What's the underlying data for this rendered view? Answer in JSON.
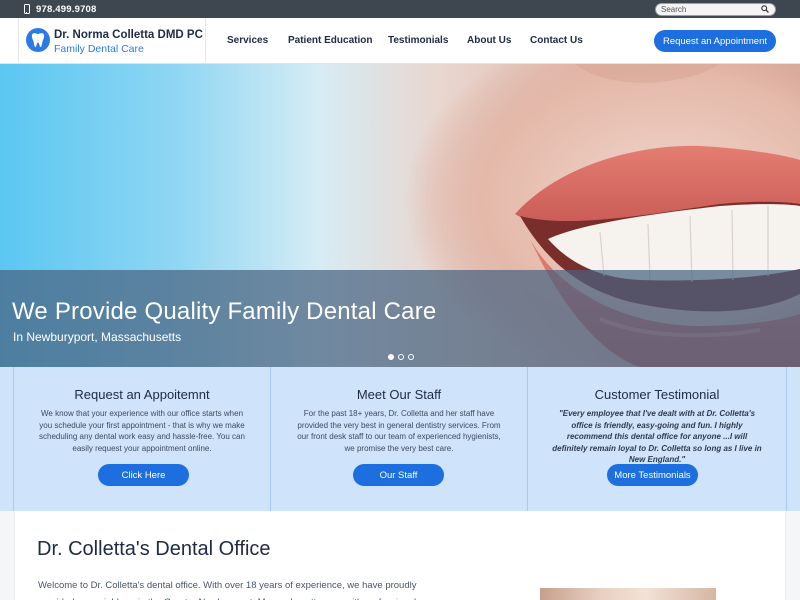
{
  "topbar": {
    "phone": "978.499.9708",
    "search_placeholder": "Search"
  },
  "header": {
    "brand_name": "Dr. Norma Colletta DMD PC",
    "brand_sub": "Family Dental Care",
    "nav": [
      "Services",
      "Patient Education",
      "Testimonials",
      "About Us",
      "Contact Us"
    ],
    "cta": "Request an Appointment"
  },
  "hero": {
    "title": "We Provide Quality Family Dental Care",
    "subtitle": "In Newburyport, Massachusetts",
    "slide_count": 3,
    "active_slide": 1
  },
  "features": [
    {
      "title": "Request an Appoitemnt",
      "text": "We know that your experience with our office starts when you schedule your first appointment - that is why we make scheduling any dental work easy and hassle-free. You can easily request your appointment online.",
      "button": "Click Here"
    },
    {
      "title": "Meet Our Staff",
      "text": "For the past 18+ years, Dr. Colletta and her staff have provided the very best in general dentistry services. From our front desk staff to our team of experienced hygienists, we promise the very best care.",
      "button": "Our Staff"
    },
    {
      "title": "Customer Testimonial",
      "text": "\"Every employee that I've dealt with at Dr. Colletta's office is friendly, easy-going and fun. I highly recommend this dental office for anyone ...I will definitely remain loyal to Dr. Colletta so long as I live in New England.\"",
      "button": "More Testimonials"
    }
  ],
  "content": {
    "title": "Dr. Colletta's Dental Office",
    "text": "Welcome to Dr. Colletta's dental office. With over 18 years of experience, we have proudly provided our neighbors in the Greater Newburyport, Massachusetts area with professional"
  },
  "colors": {
    "primary": "#1d6fe0",
    "topbar": "#3e4650",
    "feature_bg": "#cfe3fb",
    "navy": "#1f2a44"
  }
}
